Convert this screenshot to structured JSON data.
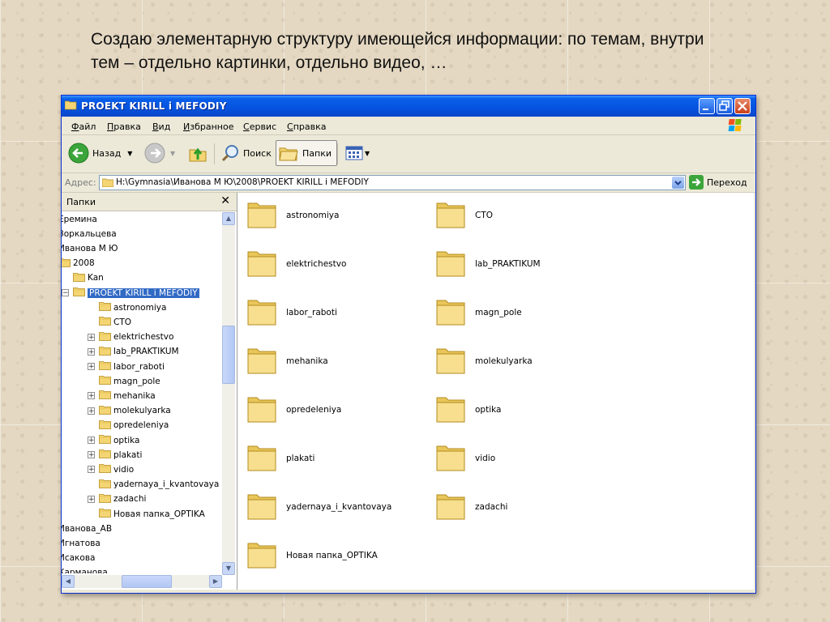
{
  "caption": "Создаю элементарную структуру имеющейся информации: по темам, внутри тем – отдельно картинки, отдельно видео, …",
  "window": {
    "title": "PROEKT KIRILL i MEFODIY",
    "menu": [
      "Файл",
      "Правка",
      "Вид",
      "Избранное",
      "Сервис",
      "Справка"
    ],
    "toolbar": {
      "back": "Назад",
      "search": "Поиск",
      "folders": "Папки"
    },
    "address": {
      "label": "Адрес:",
      "path": "H:\\Gymnasia\\Иванова М Ю\\2008\\PROEKT KIRILL i MEFODIY",
      "go": "Переход"
    }
  },
  "left_pane": {
    "title": "Папки",
    "tree": [
      {
        "label": "Еремина",
        "level": 0,
        "expander": "",
        "icon": false,
        "selected": false
      },
      {
        "label": "Зоркальцева",
        "level": 0,
        "expander": "",
        "icon": false,
        "selected": false
      },
      {
        "label": "Иванова М Ю",
        "level": 0,
        "expander": "",
        "icon": false,
        "selected": false
      },
      {
        "label": "2008",
        "level": 0,
        "expander": "",
        "icon": true,
        "selected": false
      },
      {
        "label": "Kan",
        "level": 1,
        "expander": "",
        "icon": true,
        "selected": false
      },
      {
        "label": "PROEKT KIRILL i MEFODIY",
        "level": 0,
        "expander": "−",
        "icon": true,
        "selected": true
      },
      {
        "label": "astronomiya",
        "level": 2,
        "expander": "",
        "icon": true,
        "selected": false
      },
      {
        "label": "CTO",
        "level": 2,
        "expander": "",
        "icon": true,
        "selected": false
      },
      {
        "label": "elektrichestvo",
        "level": 2,
        "expander": "+",
        "icon": true,
        "selected": false
      },
      {
        "label": "lab_PRAKTIKUM",
        "level": 2,
        "expander": "+",
        "icon": true,
        "selected": false
      },
      {
        "label": "labor_raboti",
        "level": 2,
        "expander": "+",
        "icon": true,
        "selected": false
      },
      {
        "label": "magn_pole",
        "level": 2,
        "expander": "",
        "icon": true,
        "selected": false
      },
      {
        "label": "mehanika",
        "level": 2,
        "expander": "+",
        "icon": true,
        "selected": false
      },
      {
        "label": "molekulyarka",
        "level": 2,
        "expander": "+",
        "icon": true,
        "selected": false
      },
      {
        "label": "opredeleniya",
        "level": 2,
        "expander": "",
        "icon": true,
        "selected": false
      },
      {
        "label": "optika",
        "level": 2,
        "expander": "+",
        "icon": true,
        "selected": false
      },
      {
        "label": "plakati",
        "level": 2,
        "expander": "+",
        "icon": true,
        "selected": false
      },
      {
        "label": "vidio",
        "level": 2,
        "expander": "+",
        "icon": true,
        "selected": false
      },
      {
        "label": "yadernaya_i_kvantovaya",
        "level": 2,
        "expander": "",
        "icon": true,
        "selected": false
      },
      {
        "label": "zadachi",
        "level": 2,
        "expander": "+",
        "icon": true,
        "selected": false
      },
      {
        "label": "Новая папка_OPTIKA",
        "level": 2,
        "expander": "",
        "icon": true,
        "selected": false
      },
      {
        "label": "Иванова_АВ",
        "level": 0,
        "expander": "",
        "icon": false,
        "selected": false
      },
      {
        "label": "Игнатова",
        "level": 0,
        "expander": "",
        "icon": false,
        "selected": false
      },
      {
        "label": "Исакова",
        "level": 0,
        "expander": "",
        "icon": false,
        "selected": false
      },
      {
        "label": "Карманова",
        "level": 0,
        "expander": "",
        "icon": false,
        "selected": false
      }
    ]
  },
  "folders": [
    "astronomiya",
    "CTO",
    "elektrichestvo",
    "lab_PRAKTIKUM",
    "labor_raboti",
    "magn_pole",
    "mehanika",
    "molekulyarka",
    "opredeleniya",
    "optika",
    "plakati",
    "vidio",
    "yadernaya_i_kvantovaya",
    "zadachi",
    "Новая папка_OPTIKA"
  ],
  "colors": {
    "title_bar": "#0553df",
    "selection": "#316ac5",
    "folder": "#f4d573"
  }
}
